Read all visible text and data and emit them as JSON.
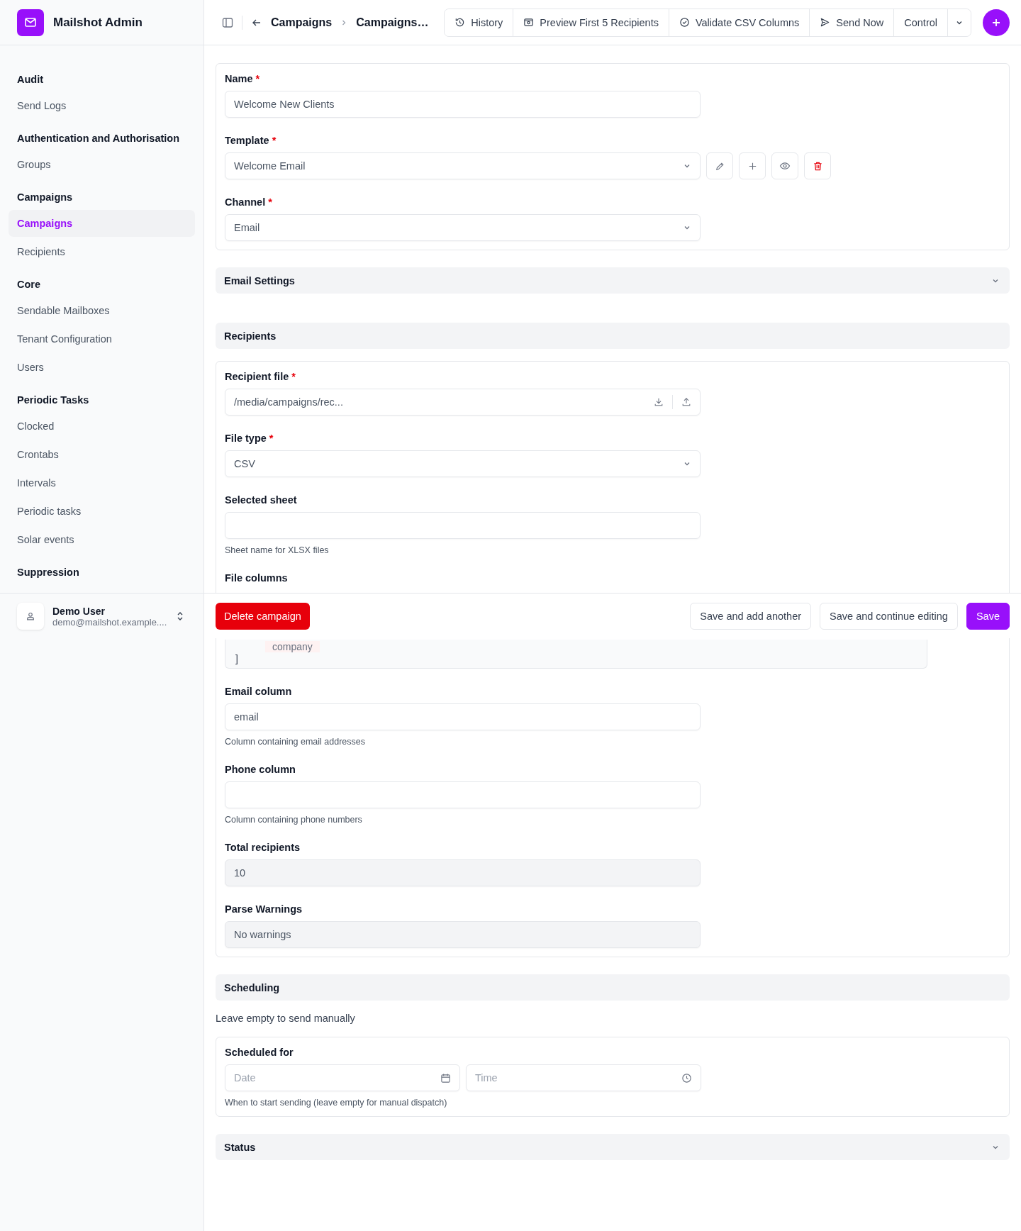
{
  "app": {
    "title": "Mailshot Admin"
  },
  "sidebar": {
    "sections": [
      {
        "heading": "Audit",
        "items": [
          {
            "label": "Send Logs",
            "selected": false
          }
        ]
      },
      {
        "heading": "Authentication and Authorisation",
        "items": [
          {
            "label": "Groups",
            "selected": false
          }
        ]
      },
      {
        "heading": "Campaigns",
        "items": [
          {
            "label": "Campaigns",
            "selected": true
          },
          {
            "label": "Recipients",
            "selected": false
          }
        ]
      },
      {
        "heading": "Core",
        "items": [
          {
            "label": "Sendable Mailboxes",
            "selected": false
          },
          {
            "label": "Tenant Configuration",
            "selected": false
          },
          {
            "label": "Users",
            "selected": false
          }
        ]
      },
      {
        "heading": "Periodic Tasks",
        "items": [
          {
            "label": "Clocked",
            "selected": false
          },
          {
            "label": "Crontabs",
            "selected": false
          },
          {
            "label": "Intervals",
            "selected": false
          },
          {
            "label": "Periodic tasks",
            "selected": false
          },
          {
            "label": "Solar events",
            "selected": false
          }
        ]
      },
      {
        "heading": "Suppression"
      }
    ],
    "user": {
      "name": "Demo User",
      "email": "demo@mailshot.example...."
    }
  },
  "topbar": {
    "breadcrumbs": [
      "Campaigns",
      "Campaigns…"
    ],
    "actions": [
      {
        "label": "History",
        "kind": "history"
      },
      {
        "label": "Preview First 5 Recipients",
        "kind": "preview"
      },
      {
        "label": "Validate CSV Columns",
        "kind": "validate"
      },
      {
        "label": "Send Now",
        "kind": "send"
      }
    ],
    "control": "Control"
  },
  "sections": [
    {
      "kind": "card",
      "fields": [
        {
          "kind": "text",
          "label": "Name",
          "required_mark": "*",
          "value": "Welcome New Clients"
        },
        {
          "kind": "select",
          "label": "Template",
          "required_mark": "*",
          "value": "Welcome Email",
          "has_actions": true
        },
        {
          "kind": "select",
          "label": "Channel",
          "required_mark": "*",
          "value": "Email"
        }
      ]
    },
    {
      "kind": "header",
      "title": "Email Settings",
      "collapsible": true
    },
    {
      "kind": "header",
      "title": "Recipients",
      "collapsible": false
    },
    {
      "kind": "card",
      "fields": [
        {
          "kind": "file",
          "label": "Recipient file",
          "required_mark": "*",
          "value": "/media/campaigns/rec..."
        },
        {
          "kind": "select",
          "label": "File type",
          "required_mark": "*",
          "value": "CSV"
        },
        {
          "kind": "text",
          "label": "Selected sheet",
          "help": "Sheet name for XLSX files"
        },
        {
          "kind": "code",
          "label": "File columns",
          "token": "company",
          "closing": "]"
        },
        {
          "kind": "text",
          "label": "Email column",
          "value": "email",
          "help": "Column containing email addresses"
        },
        {
          "kind": "text",
          "label": "Phone column",
          "help": "Column containing phone numbers"
        },
        {
          "kind": "text",
          "label": "Total recipients",
          "value": "10",
          "readonly": true
        },
        {
          "kind": "text",
          "label": "Parse Warnings",
          "value": "No warnings",
          "readonly": true
        }
      ]
    },
    {
      "kind": "header",
      "title": "Scheduling",
      "collapsible": false
    },
    {
      "kind": "note",
      "text": "Leave empty to send manually"
    },
    {
      "kind": "card",
      "fields": [
        {
          "kind": "datetime",
          "label": "Scheduled for",
          "date_placeholder": "Date",
          "time_placeholder": "Time",
          "help": "When to start sending (leave empty for manual dispatch)"
        }
      ]
    },
    {
      "kind": "header",
      "title": "Status",
      "collapsible": true
    }
  ],
  "footer": {
    "delete": "Delete campaign",
    "buttons": [
      {
        "label": "Save and add another",
        "kind": "secondary"
      },
      {
        "label": "Save and continue editing",
        "kind": "secondary"
      },
      {
        "label": "Save",
        "kind": "primary"
      }
    ]
  }
}
